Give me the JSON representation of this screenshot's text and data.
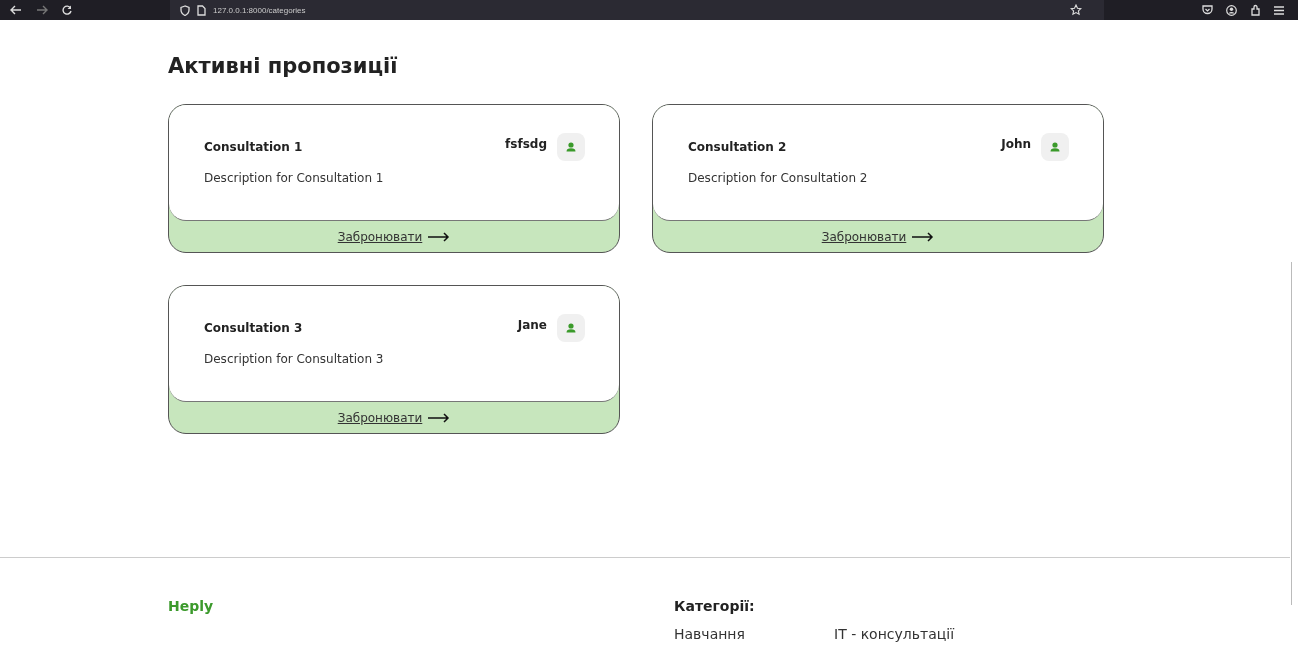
{
  "browser": {
    "url": "127.0.0.1:8000/categories"
  },
  "heading": "Активні пропозиції",
  "offers": [
    {
      "title": "Consultation 1",
      "author": "fsfsdg",
      "description": "Description for Consultation 1",
      "action": "Забронювати"
    },
    {
      "title": "Consultation 2",
      "author": "John",
      "description": "Description for Consultation 2",
      "action": "Забронювати"
    },
    {
      "title": "Consultation 3",
      "author": "Jane",
      "description": "Description for Consultation 3",
      "action": "Забронювати"
    }
  ],
  "footer": {
    "brand": "Heply",
    "categories_title": "Категорії:",
    "categories": [
      "Навчання",
      "IT - консультації"
    ]
  }
}
